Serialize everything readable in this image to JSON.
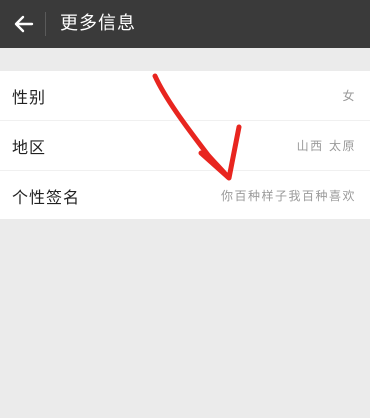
{
  "header": {
    "back_icon": "arrow-left-icon",
    "title": "更多信息"
  },
  "info": {
    "rows": [
      {
        "label": "性别",
        "value": "女"
      },
      {
        "label": "地区",
        "value": "山西  太原"
      },
      {
        "label": "个性签名",
        "value": "你百种样子我百种喜欢"
      }
    ]
  },
  "colors": {
    "header_bg": "#3a3a3a",
    "page_bg": "#ebebeb",
    "card_bg": "#ffffff",
    "annotation_arrow": "#e8251f"
  }
}
